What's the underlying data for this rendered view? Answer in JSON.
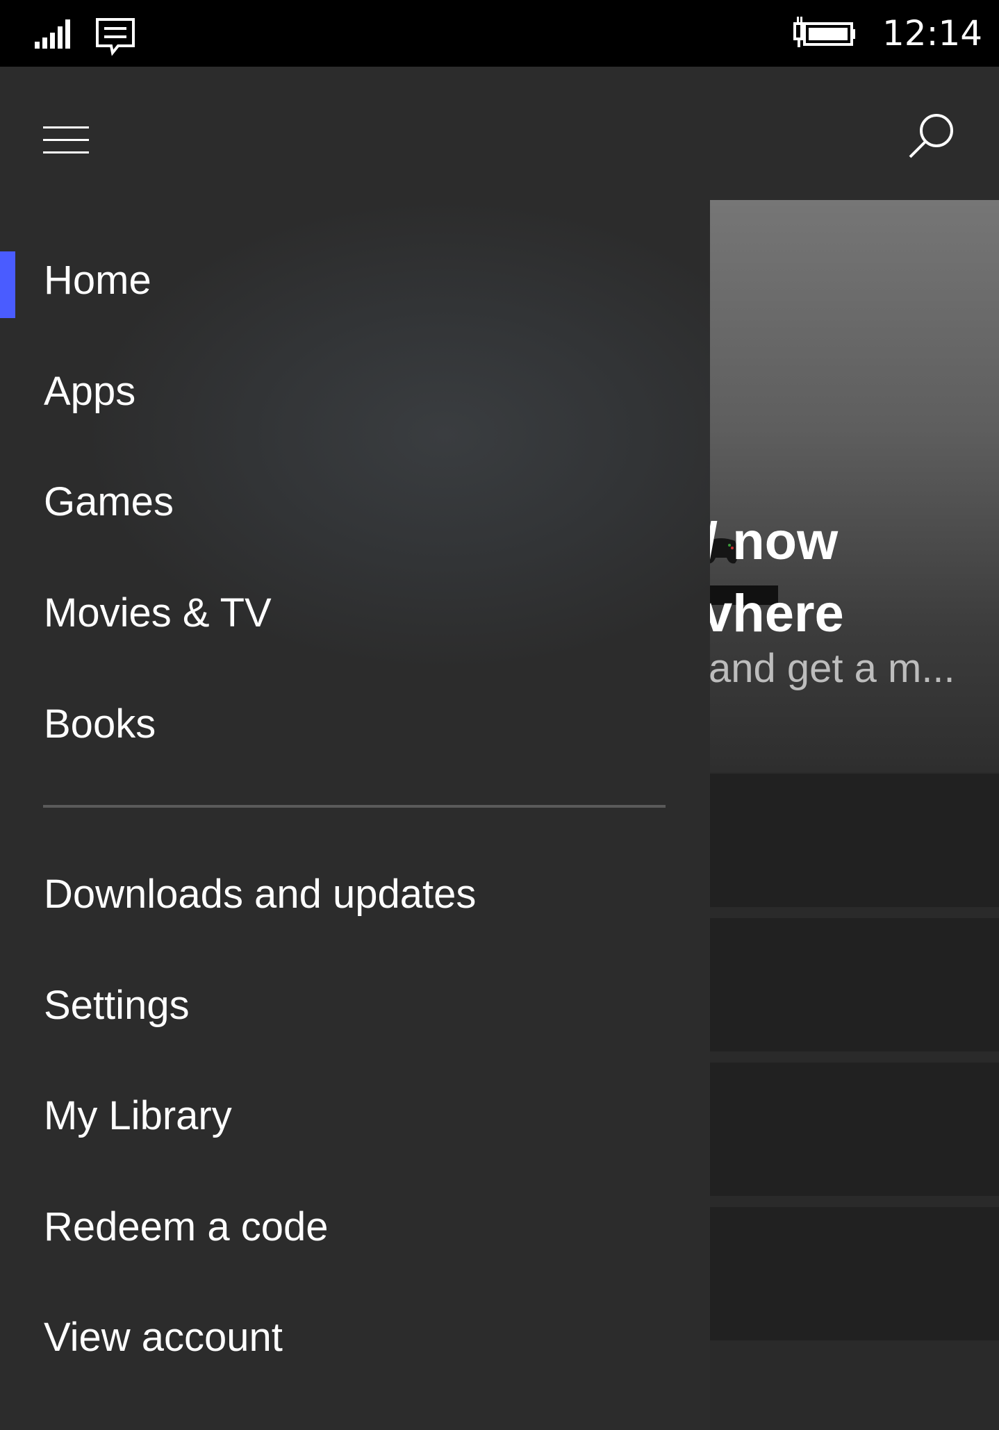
{
  "status_bar": {
    "time": "12:14",
    "icons": [
      "signal-icon",
      "message-icon",
      "battery-charging-icon"
    ]
  },
  "header": {
    "menu_icon": "hamburger-icon",
    "search_icon": "search-icon"
  },
  "nav": {
    "primary": [
      {
        "label": "Home",
        "selected": true
      },
      {
        "label": "Apps",
        "selected": false
      },
      {
        "label": "Games",
        "selected": false
      },
      {
        "label": "Movies & TV",
        "selected": false
      },
      {
        "label": "Books",
        "selected": false
      }
    ],
    "secondary": [
      {
        "label": "Downloads and updates"
      },
      {
        "label": "Settings"
      },
      {
        "label": "My Library"
      },
      {
        "label": "Redeem a code"
      },
      {
        "label": "View account"
      }
    ],
    "accent_color": "#4a5cff"
  },
  "hero": {
    "title_line1": "/ now",
    "title_line2": "vhere",
    "subtitle": "and get a m..."
  }
}
